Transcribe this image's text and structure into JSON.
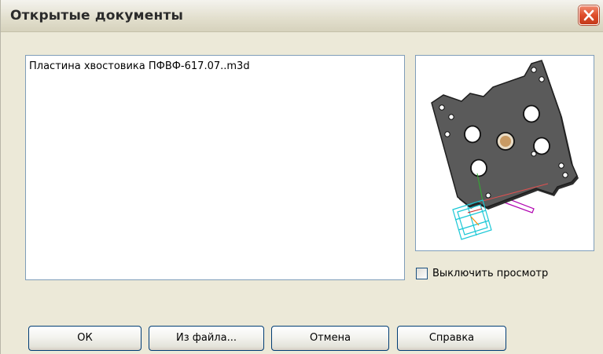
{
  "window": {
    "title": "Открытые документы"
  },
  "documents": {
    "items": [
      {
        "label": "Пластина хвостовика ПФВФ-617.07..m3d"
      }
    ]
  },
  "preview": {
    "disable_label": "Выключить просмотр",
    "disabled": false
  },
  "buttons": {
    "ok": "ОК",
    "from_file": "Из файла...",
    "cancel": "Отмена",
    "help": "Справка"
  },
  "icons": {
    "close": "close-icon"
  },
  "colors": {
    "title_close_bg": "#de4d2b",
    "part_color": "#4a4a4a",
    "csys_color": "#19c7d6",
    "contour_color": "#b000b0"
  }
}
